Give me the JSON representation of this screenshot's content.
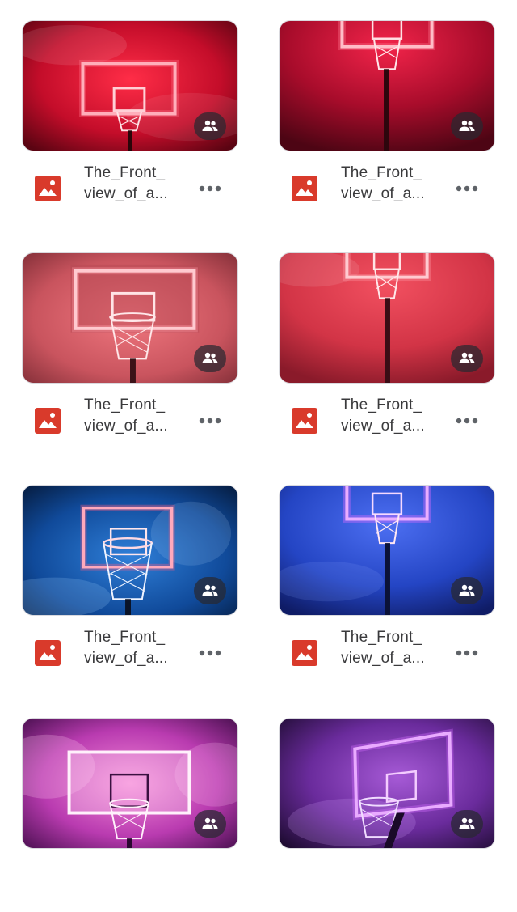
{
  "files": [
    {
      "name_line1": "The_Front_",
      "name_line2": "view_of_a...",
      "shared": true,
      "file_type": "image",
      "icon": "image-file-icon",
      "scene": "red-smoke"
    },
    {
      "name_line1": "The_Front_",
      "name_line2": "view_of_a...",
      "shared": true,
      "file_type": "image",
      "icon": "image-file-icon",
      "scene": "red-top"
    },
    {
      "name_line1": "The_Front_",
      "name_line2": "view_of_a...",
      "shared": true,
      "file_type": "image",
      "icon": "image-file-icon",
      "scene": "salmon"
    },
    {
      "name_line1": "The_Front_",
      "name_line2": "view_of_a...",
      "shared": true,
      "file_type": "image",
      "icon": "image-file-icon",
      "scene": "red-pole"
    },
    {
      "name_line1": "The_Front_",
      "name_line2": "view_of_a...",
      "shared": true,
      "file_type": "image",
      "icon": "image-file-icon",
      "scene": "blue-pink"
    },
    {
      "name_line1": "The_Front_",
      "name_line2": "view_of_a...",
      "shared": true,
      "file_type": "image",
      "icon": "image-file-icon",
      "scene": "blue-purple"
    },
    {
      "name_line1": "",
      "name_line2": "",
      "shared": true,
      "file_type": "image",
      "icon": "image-file-icon",
      "scene": "magenta-smoke"
    },
    {
      "name_line1": "",
      "name_line2": "",
      "shared": true,
      "file_type": "image",
      "icon": "image-file-icon",
      "scene": "purple-angle"
    }
  ],
  "colors": {
    "file_icon_red": "#d93a2b",
    "filename_text": "#3a3a3c",
    "more_dots": "#5f6368",
    "badge_bg": "#2c2c34"
  },
  "icons": {
    "shared": "people-icon",
    "more": "more-horizontal-icon",
    "file": "image-file-icon"
  }
}
